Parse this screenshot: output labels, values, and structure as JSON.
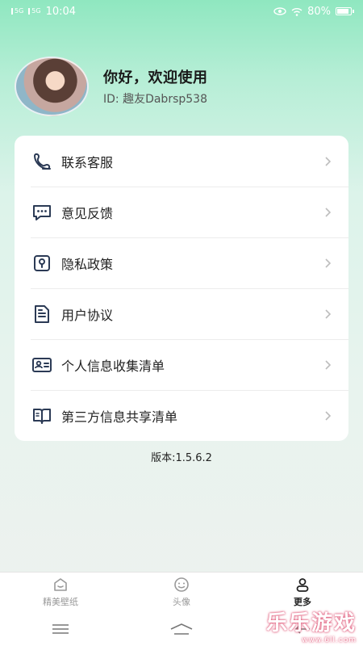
{
  "status_bar": {
    "time": "10:04",
    "sim1": "5G",
    "sim2": "5G",
    "battery": "80%"
  },
  "profile": {
    "greeting": "你好，欢迎使用",
    "user_id": "ID: 趣友Dabrsp538"
  },
  "menu": {
    "items": [
      {
        "label": "联系客服",
        "icon": "customer-service-icon"
      },
      {
        "label": "意见反馈",
        "icon": "feedback-icon"
      },
      {
        "label": "隐私政策",
        "icon": "privacy-icon"
      },
      {
        "label": "用户协议",
        "icon": "document-icon"
      },
      {
        "label": "个人信息收集清单",
        "icon": "id-card-icon"
      },
      {
        "label": "第三方信息共享清单",
        "icon": "book-icon"
      }
    ]
  },
  "version": "版本:1.5.6.2",
  "tabbar": {
    "tabs": [
      {
        "label": "精美壁纸",
        "icon": "wallpaper-icon",
        "active": false
      },
      {
        "label": "头像",
        "icon": "face-icon",
        "active": false
      },
      {
        "label": "更多",
        "icon": "user-icon",
        "active": true
      }
    ]
  },
  "watermark": {
    "main": "乐乐游戏",
    "url": "www.6ll.com"
  }
}
